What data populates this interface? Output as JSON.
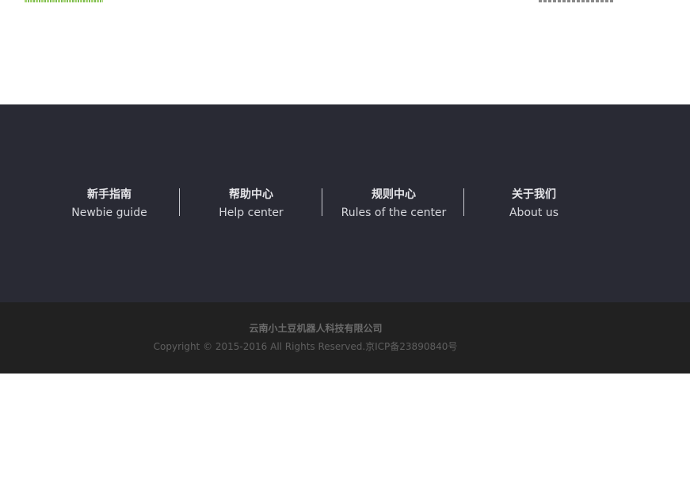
{
  "nav": {
    "items": [
      {
        "cn": "新手指南",
        "en": "Newbie guide"
      },
      {
        "cn": "帮助中心",
        "en": "Help center"
      },
      {
        "cn": "规则中心",
        "en": "Rules of the center"
      },
      {
        "cn": "关于我们",
        "en": "About us"
      }
    ]
  },
  "footer": {
    "company": "云南小土豆机器人科技有限公司",
    "copyright": "Copyright © 2015-2016  All Rights Reserved.京ICP备23890840号"
  },
  "colors": {
    "nav_bg": "#292a34",
    "copy_bg": "#212121"
  }
}
